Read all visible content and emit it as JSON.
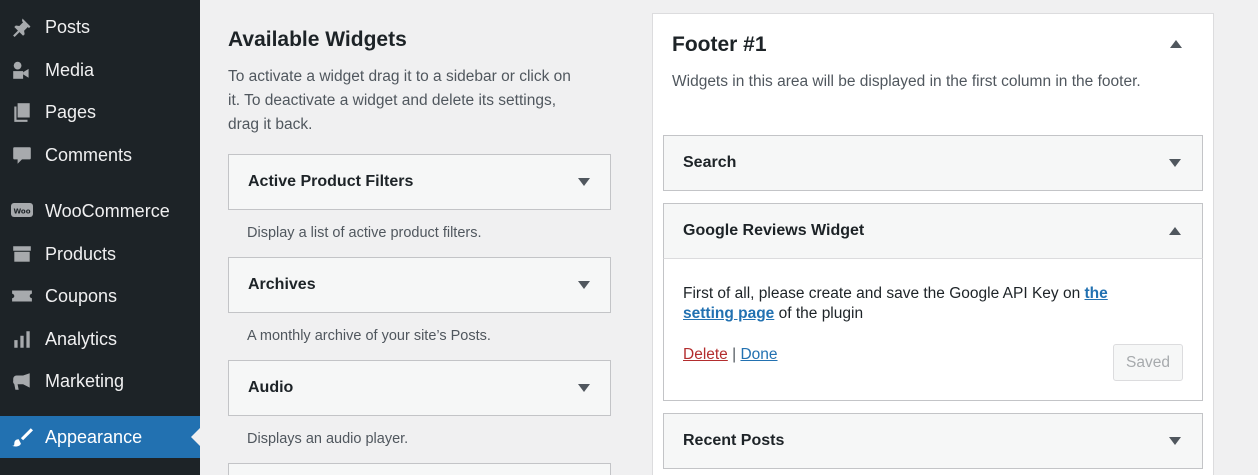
{
  "sidebar": {
    "items": [
      {
        "label": "Posts",
        "icon": "pin-icon"
      },
      {
        "label": "Media",
        "icon": "media-icon"
      },
      {
        "label": "Pages",
        "icon": "pages-icon"
      },
      {
        "label": "Comments",
        "icon": "comment-icon"
      },
      {
        "label": "WooCommerce",
        "icon": "woo-icon"
      },
      {
        "label": "Products",
        "icon": "archive-icon"
      },
      {
        "label": "Coupons",
        "icon": "ticket-icon"
      },
      {
        "label": "Analytics",
        "icon": "bar-chart-icon"
      },
      {
        "label": "Marketing",
        "icon": "megaphone-icon"
      },
      {
        "label": "Appearance",
        "icon": "brush-icon",
        "active": true
      }
    ],
    "colors": {
      "bg": "#1d2327",
      "active": "#2271b1"
    }
  },
  "available": {
    "title": "Available Widgets",
    "description": "To activate a widget drag it to a sidebar or click on it. To deactivate a widget and delete its settings, drag it back.",
    "widgets": [
      {
        "name": "Active Product Filters",
        "description": "Display a list of active product filters."
      },
      {
        "name": "Archives",
        "description": "A monthly archive of your site’s Posts."
      },
      {
        "name": "Audio",
        "description": "Displays an audio player."
      }
    ]
  },
  "footer": {
    "title": "Footer #1",
    "description": "Widgets in this area will be displayed in the first column in the footer.",
    "widgets": [
      {
        "name": "Search"
      },
      {
        "name": "Google Reviews Widget",
        "expanded": true
      },
      {
        "name": "Recent Posts"
      }
    ],
    "google_reviews": {
      "text_before": "First of all, please create and save the Google API Key on ",
      "link_text": "the setting page",
      "text_after": " of the plugin",
      "delete_label": "Delete",
      "separator": "|",
      "done_label": "Done",
      "saved_label": "Saved"
    }
  }
}
